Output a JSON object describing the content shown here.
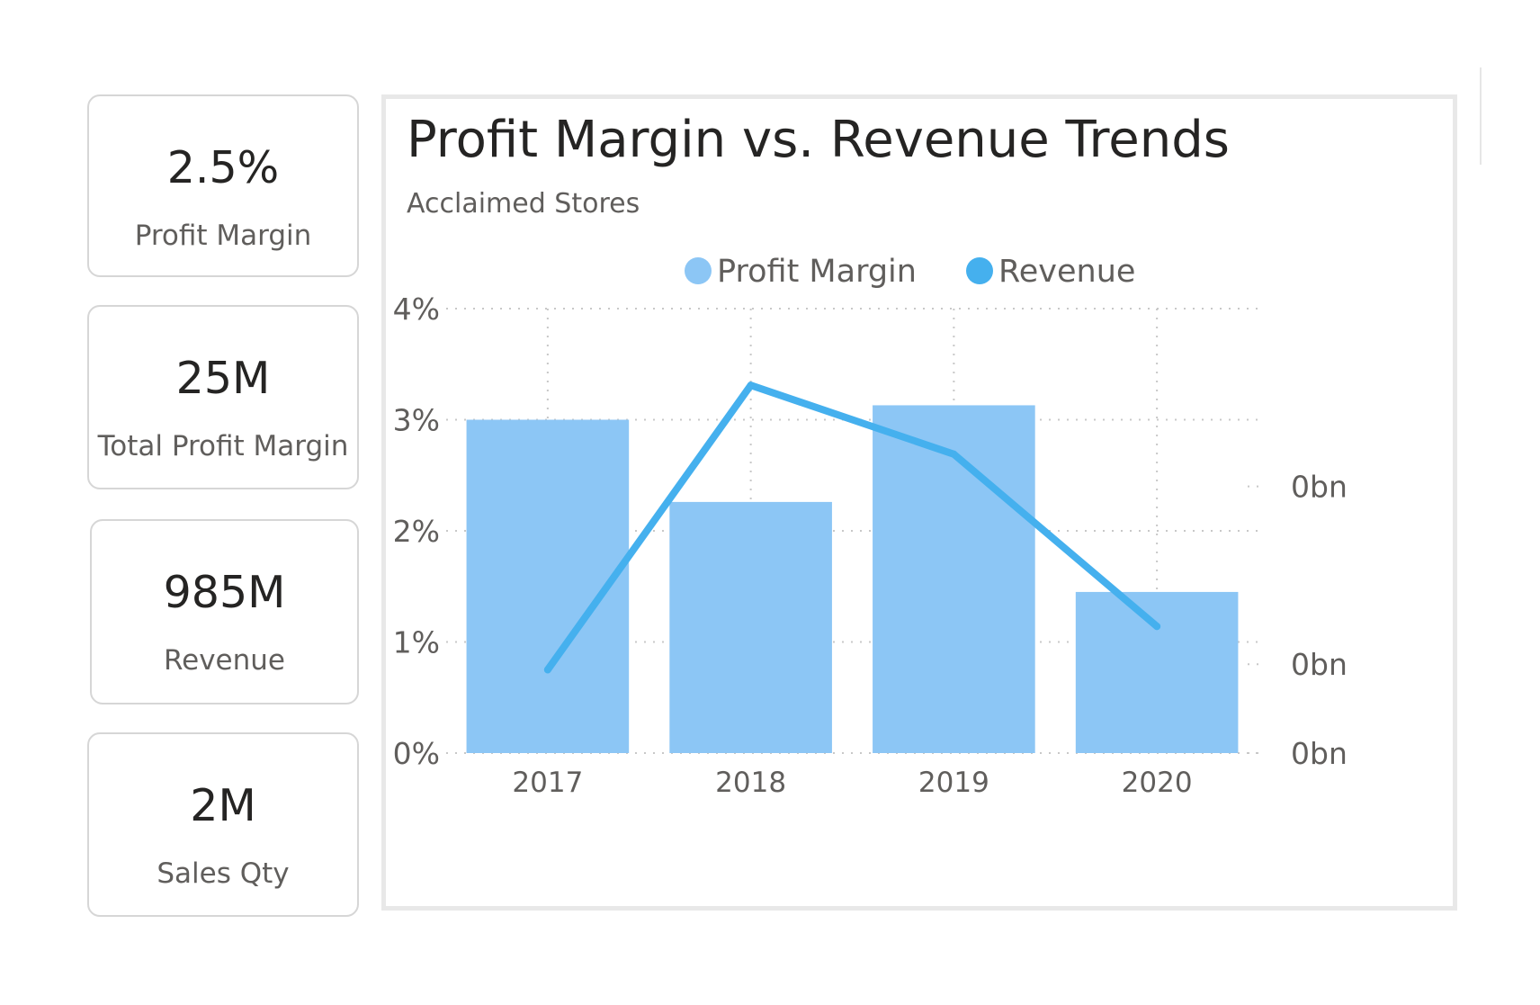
{
  "kpis": [
    {
      "value": "2.5%",
      "label": "Profit Margin"
    },
    {
      "value": "25M",
      "label": "Total Profit Margin"
    },
    {
      "value": "985M",
      "label": "Revenue"
    },
    {
      "value": "2M",
      "label": "Sales Qty"
    }
  ],
  "colors": {
    "bar": "#8cc6f5",
    "line": "#45b0ee",
    "grid": "#c8c8c8",
    "axis_text": "#605e5c",
    "title": "#252423"
  },
  "chart_data": {
    "type": "bar+line",
    "title": "Profit Margin vs. Revenue Trends",
    "subtitle": "Acclaimed Stores",
    "legend": {
      "position": "top-center",
      "entries": [
        "Profit Margin",
        "Revenue"
      ]
    },
    "categories": [
      "2017",
      "2018",
      "2019",
      "2020"
    ],
    "series": [
      {
        "name": "Profit Margin",
        "kind": "bar",
        "axis": "left",
        "values": [
          3.0,
          2.26,
          3.13,
          1.45
        ]
      },
      {
        "name": "Revenue",
        "kind": "line",
        "axis": "right",
        "values": [
          0.75,
          3.31,
          2.69,
          1.14
        ]
      }
    ],
    "y_left": {
      "ticks": [
        "0%",
        "1%",
        "2%",
        "3%",
        "4%"
      ],
      "range": [
        0,
        4
      ]
    },
    "y_right": {
      "ticks": [
        "0bn",
        "0bn",
        "0bn"
      ]
    },
    "grid": true
  }
}
